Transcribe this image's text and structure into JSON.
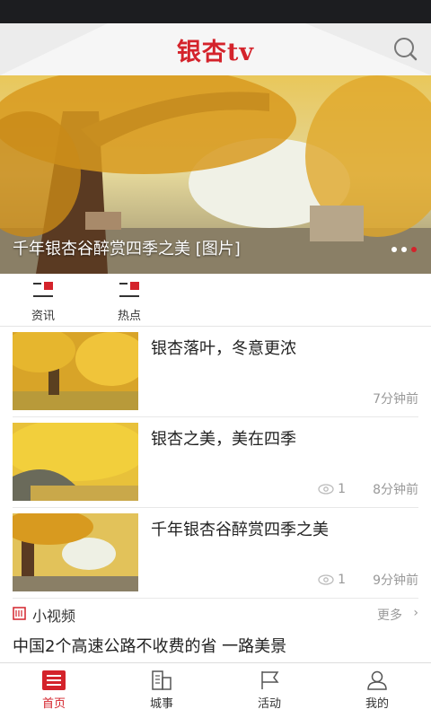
{
  "app": {
    "title": "银杏tv"
  },
  "header": {
    "search_icon": "search-icon"
  },
  "banner": {
    "caption": "千年银杏谷醉赏四季之美 [图片]",
    "dots": 3,
    "active_dot": 3
  },
  "categories": [
    {
      "label": "资讯",
      "icon": "news-icon"
    },
    {
      "label": "热点",
      "icon": "hot-icon"
    }
  ],
  "news": [
    {
      "title": "银杏落叶，冬意更浓",
      "views": "",
      "time": "7分钟前"
    },
    {
      "title": "银杏之美，美在四季",
      "views": "1",
      "time": "8分钟前"
    },
    {
      "title": "千年银杏谷醉赏四季之美",
      "views": "1",
      "time": "9分钟前"
    }
  ],
  "section": {
    "title": "小视频",
    "more": "更多",
    "video_title": "中国2个高速公路不收费的省 一路美景"
  },
  "tabs": [
    {
      "label": "首页",
      "icon": "home-icon",
      "active": true
    },
    {
      "label": "城事",
      "icon": "city-icon",
      "active": false
    },
    {
      "label": "活动",
      "icon": "flag-icon",
      "active": false
    },
    {
      "label": "我的",
      "icon": "user-icon",
      "active": false
    }
  ],
  "colors": {
    "accent": "#d4232b",
    "text": "#222222",
    "muted": "#999999"
  }
}
